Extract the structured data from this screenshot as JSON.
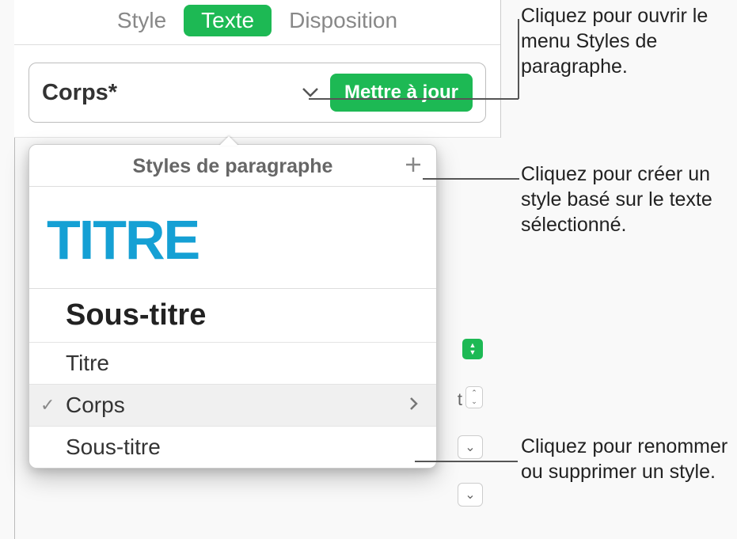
{
  "tabs": {
    "style": "Style",
    "texte": "Texte",
    "disposition": "Disposition"
  },
  "style_row": {
    "name": "Corps*",
    "update_button": "Mettre à jour"
  },
  "popover": {
    "title": "Styles de paragraphe",
    "preview_text": "TITRE",
    "items": {
      "sous_titre": "Sous-titre",
      "titre": "Titre",
      "corps": "Corps",
      "sous_titre2": "Sous-titre"
    }
  },
  "bg": {
    "t_label": "t"
  },
  "callouts": {
    "c1": "Cliquez pour ouvrir le menu Styles de paragraphe.",
    "c2": "Cliquez pour créer un style basé sur le texte sélectionné.",
    "c3": "Cliquez pour renommer ou supprimer un style."
  }
}
